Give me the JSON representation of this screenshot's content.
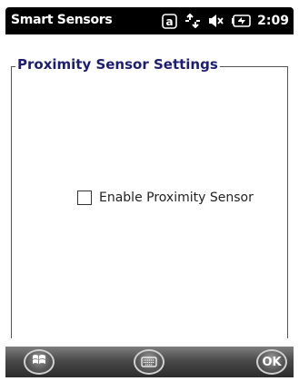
{
  "status_bar": {
    "app_title": "Smart Sensors",
    "icons": [
      "a-key-icon",
      "connectivity-arrows-icon",
      "speaker-muted-icon",
      "battery-charging-icon"
    ],
    "a_key": "a",
    "time": "2:09"
  },
  "main": {
    "group_title": "Proximity Sensor Settings",
    "enable_checkbox": {
      "label": "Enable Proximity Sensor",
      "checked": false
    }
  },
  "bottom_bar": {
    "start_icon": "windows-start-icon",
    "keyboard_icon": "keyboard-icon",
    "ok_label": "OK"
  },
  "colors": {
    "status_bar_bg": "#000000",
    "group_title": "#1e1e6e",
    "bottom_bar_bg": "#3a3a3a"
  }
}
